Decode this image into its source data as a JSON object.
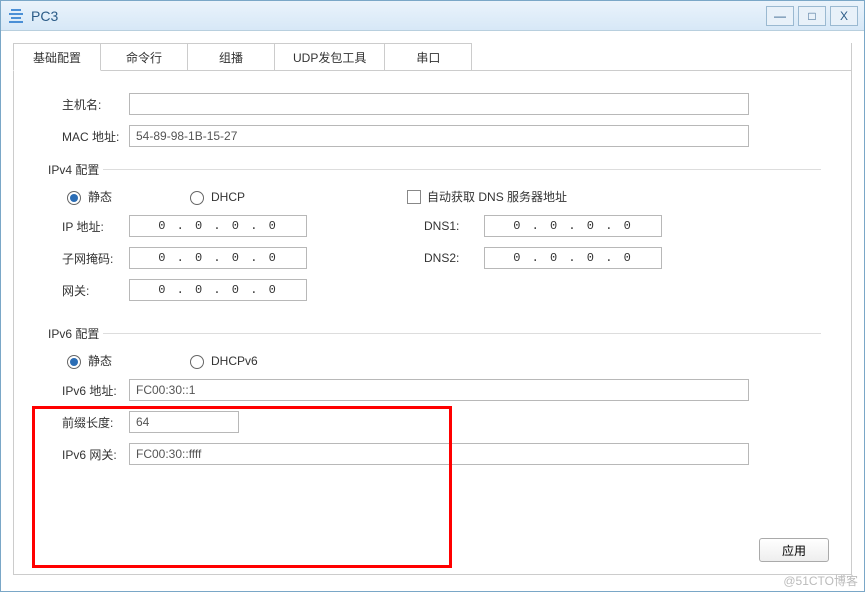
{
  "window": {
    "title": "PC3",
    "min": "—",
    "max": "□",
    "close": "X"
  },
  "tabs": {
    "t0": "基础配置",
    "t1": "命令行",
    "t2": "组播",
    "t3": "UDP发包工具",
    "t4": "串口"
  },
  "basic": {
    "host_label": "主机名:",
    "host_value": "",
    "mac_label": "MAC 地址:",
    "mac_value": "54-89-98-1B-15-27"
  },
  "ipv4": {
    "legend": "IPv4 配置",
    "static_label": "静态",
    "dhcp_label": "DHCP",
    "autodns_label": "自动获取 DNS 服务器地址",
    "ip_label": "IP 地址:",
    "ip_value": "0   .  0   .  0   .  0",
    "mask_label": "子网掩码:",
    "mask_value": "0   .  0   .  0   .  0",
    "gw_label": "网关:",
    "gw_value": "0   .  0   .  0   .  0",
    "dns1_label": "DNS1:",
    "dns1_value": "0   .  0   .  0   .  0",
    "dns2_label": "DNS2:",
    "dns2_value": "0   .  0   .  0   .  0"
  },
  "ipv6": {
    "legend": "IPv6 配置",
    "static_label": "静态",
    "dhcp_label": "DHCPv6",
    "addr_label": "IPv6 地址:",
    "addr_value": "FC00:30::1",
    "prefix_label": "前缀长度:",
    "prefix_value": "64",
    "gw_label": "IPv6 网关:",
    "gw_value": "FC00:30::ffff"
  },
  "footer": {
    "apply": "应用"
  },
  "watermark": "@51CTO博客"
}
